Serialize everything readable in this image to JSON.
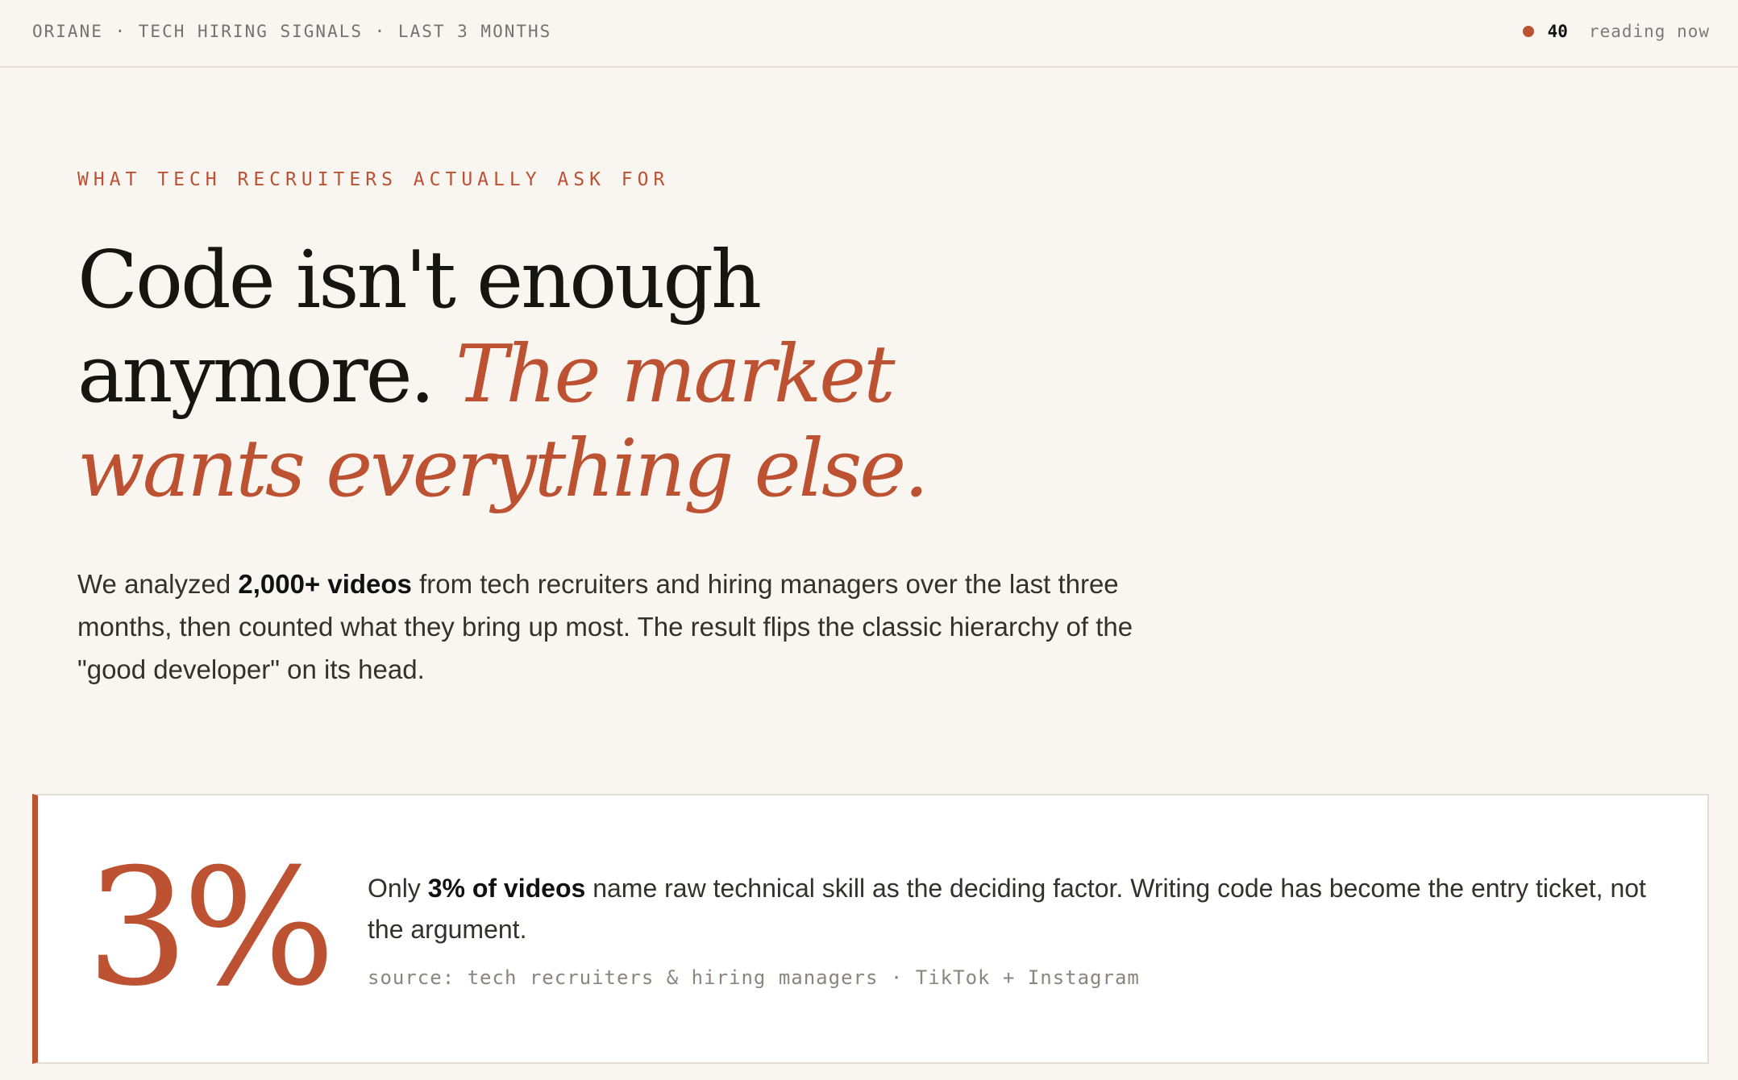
{
  "topbar": {
    "title": "ORIANE · TECH HIRING SIGNALS · LAST 3 MONTHS",
    "readers_count": "40",
    "readers_label": "reading now"
  },
  "hero": {
    "eyebrow": "WHAT TECH RECRUITERS ACTUALLY ASK FOR",
    "headline_plain": "Code isn't enough anymore. ",
    "headline_accent": "The market wants everything else.",
    "lede_before": "We analyzed ",
    "lede_bold": "2,000+ videos",
    "lede_after": " from tech recruiters and hiring managers over the last three months, then counted what they bring up most. The result flips the classic hierarchy of the \"good developer\" on its head."
  },
  "stat": {
    "value": "3%",
    "text_before": "Only ",
    "text_bold": "3% of videos",
    "text_after": " name raw technical skill as the deciding factor. Writing code has become the entry ticket, not the argument.",
    "source": "source: tech recruiters & hiring managers · TikTok + Instagram"
  },
  "colors": {
    "accent": "#bd5232",
    "background": "#f9f6f1",
    "card": "#ffffff"
  }
}
